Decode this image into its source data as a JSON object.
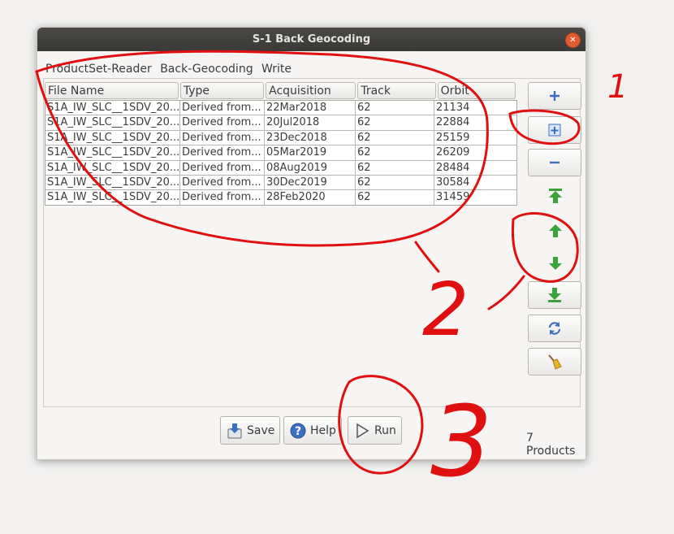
{
  "window": {
    "title": "S-1 Back Geocoding"
  },
  "tabs": [
    "ProductSet-Reader",
    "Back-Geocoding",
    "Write"
  ],
  "table": {
    "headers": [
      "File Name",
      "Type",
      "Acquisition",
      "Track",
      "Orbit"
    ],
    "rows": [
      [
        "S1A_IW_SLC__1SDV_20...",
        "Derived from...",
        "22Mar2018",
        "62",
        "21134"
      ],
      [
        "S1A_IW_SLC__1SDV_20...",
        "Derived from...",
        "20Jul2018",
        "62",
        "22884"
      ],
      [
        "S1A_IW_SLC__1SDV_20...",
        "Derived from...",
        "23Dec2018",
        "62",
        "25159"
      ],
      [
        "S1A_IW_SLC__1SDV_20...",
        "Derived from...",
        "05Mar2019",
        "62",
        "26209"
      ],
      [
        "S1A_IW_SLC__1SDV_20...",
        "Derived from...",
        "08Aug2019",
        "62",
        "28484"
      ],
      [
        "S1A_IW_SLC__1SDV_20...",
        "Derived from...",
        "30Dec2019",
        "62",
        "30584"
      ],
      [
        "S1A_IW_SLC__1SDV_20...",
        "Derived from...",
        "28Feb2020",
        "62",
        "31459"
      ]
    ]
  },
  "product_count": "7 Products",
  "buttons": {
    "save": "Save",
    "help": "Help",
    "run": "Run"
  },
  "annotations": {
    "one": "1",
    "two": "2",
    "three": "3"
  },
  "colors": {
    "accent_blue": "#3b6fc4",
    "green": "#3aa33a",
    "annotation_red": "#e01010",
    "close": "#e25a32"
  }
}
